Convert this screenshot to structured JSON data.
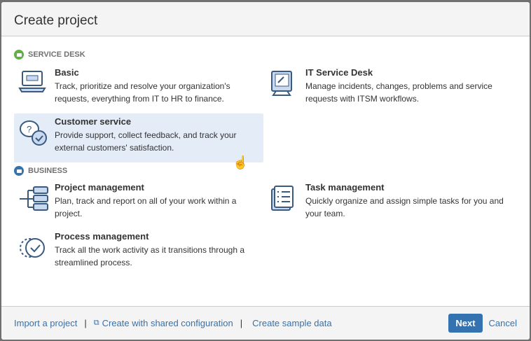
{
  "dialog": {
    "title": "Create project"
  },
  "sections": [
    {
      "label": "SERVICE DESK",
      "color": "#60b044",
      "items": [
        {
          "name": "Basic",
          "desc": "Track, prioritize and resolve your organization's requests, everything from IT to HR to finance."
        },
        {
          "name": "IT Service Desk",
          "desc": "Manage incidents, changes, problems and service requests with ITSM workflows."
        },
        {
          "name": "Customer service",
          "desc": "Provide support, collect feedback, and track your external customers' satisfaction."
        }
      ]
    },
    {
      "label": "BUSINESS",
      "color": "#3572b0",
      "items": [
        {
          "name": "Project management",
          "desc": "Plan, track and report on all of your work within a project."
        },
        {
          "name": "Task management",
          "desc": "Quickly organize and assign simple tasks for you and your team."
        },
        {
          "name": "Process management",
          "desc": "Track all the work activity as it transitions through a streamlined process."
        }
      ]
    }
  ],
  "footer": {
    "import": "Import a project",
    "shared": "Create with shared configuration",
    "sample": "Create sample data",
    "sep": "|",
    "next": "Next",
    "cancel": "Cancel"
  }
}
